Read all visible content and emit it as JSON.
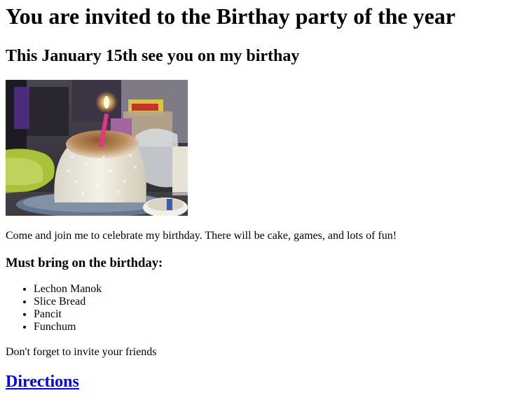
{
  "heading": "You are invited to the Birthay party of the year",
  "subheading": "This January 15th see you on my birthay",
  "photo": {
    "icon": "birthday-cake-photo"
  },
  "intro": "Come and join me to celebrate my birthday. There will be cake, games, and lots of fun!",
  "bring": {
    "title": "Must bring on the birthday:",
    "items": [
      "Lechon Manok",
      "Slice Bread",
      "Pancit",
      "Funchum"
    ]
  },
  "reminder": "Don't forget to invite your friends",
  "directions": {
    "label": "Directions"
  },
  "colors": {
    "link": "#0000ee",
    "text": "#000000",
    "background": "#ffffff"
  }
}
